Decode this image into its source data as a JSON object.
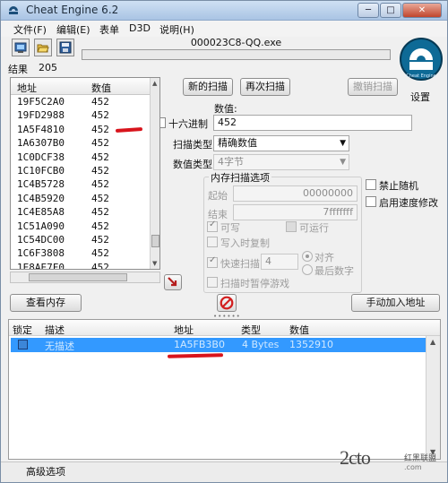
{
  "window": {
    "title": "Cheat Engine 6.2",
    "controls": {
      "minimize": "─",
      "maximize": "□",
      "close": "✕"
    }
  },
  "menu": [
    "文件(F)",
    "编辑(E)",
    "表单",
    "D3D",
    "说明(H)"
  ],
  "toolbar": {
    "icons": [
      "open-process-icon",
      "open-file-icon",
      "save-icon"
    ]
  },
  "process": {
    "name": "000023C8-QQ.exe"
  },
  "settings_label": "设置",
  "results": {
    "label": "结果",
    "count": "205"
  },
  "address_list": {
    "columns": [
      "地址",
      "数值"
    ],
    "rows": [
      {
        "address": "19F5C2A0",
        "value": "452"
      },
      {
        "address": "19FD2988",
        "value": "452"
      },
      {
        "address": "1A5F4810",
        "value": "452"
      },
      {
        "address": "1A6307B0",
        "value": "452"
      },
      {
        "address": "1C0DCF38",
        "value": "452"
      },
      {
        "address": "1C10FCB0",
        "value": "452"
      },
      {
        "address": "1C4B5728",
        "value": "452"
      },
      {
        "address": "1C4B5920",
        "value": "452"
      },
      {
        "address": "1C4E85A8",
        "value": "452"
      },
      {
        "address": "1C51A090",
        "value": "452"
      },
      {
        "address": "1C54DC00",
        "value": "452"
      },
      {
        "address": "1C6F3808",
        "value": "452"
      },
      {
        "address": "1E8AE7F0",
        "value": "452"
      }
    ]
  },
  "scan": {
    "new_scan": "新的扫描",
    "next_scan": "再次扫描",
    "undo_scan": "撤销扫描",
    "value_label": "数值:",
    "hex_label": "十六进制",
    "value": "452",
    "scan_type_label": "扫描类型",
    "scan_type": "精确数值",
    "value_type_label": "数值类型",
    "value_type": "4字节",
    "memory_options_title": "内存扫描选项",
    "start_label": "起始",
    "start_value": "00000000",
    "stop_label": "结束",
    "stop_value": "7fffffff",
    "writable": "可写",
    "executable": "可运行",
    "copy_on_write": "写入时复制",
    "fast_scan": "快速扫描",
    "fast_scan_value": "4",
    "alignment": "对齐",
    "last_digits": "最后数字",
    "pause_game": "扫描时暂停游戏",
    "disable_random": "禁止随机",
    "enable_speedhack": "启用速度修改"
  },
  "buttons": {
    "memory_view": "查看内存",
    "add_address": "手动加入地址"
  },
  "cheat_table": {
    "columns": [
      "锁定",
      "描述",
      "地址",
      "类型",
      "数值"
    ],
    "rows": [
      {
        "description": "无描述",
        "address": "1A5FB3B0",
        "type": "4 Bytes",
        "value": "1352910"
      }
    ]
  },
  "advanced_options": "高级选项",
  "watermark": {
    "logo": "2cto",
    "brand": "红黑联盟",
    "domain": ".com"
  },
  "colors": {
    "selection": "#3399ff",
    "annotation": "#d8141c",
    "logo_ring": "#0e6a96"
  }
}
